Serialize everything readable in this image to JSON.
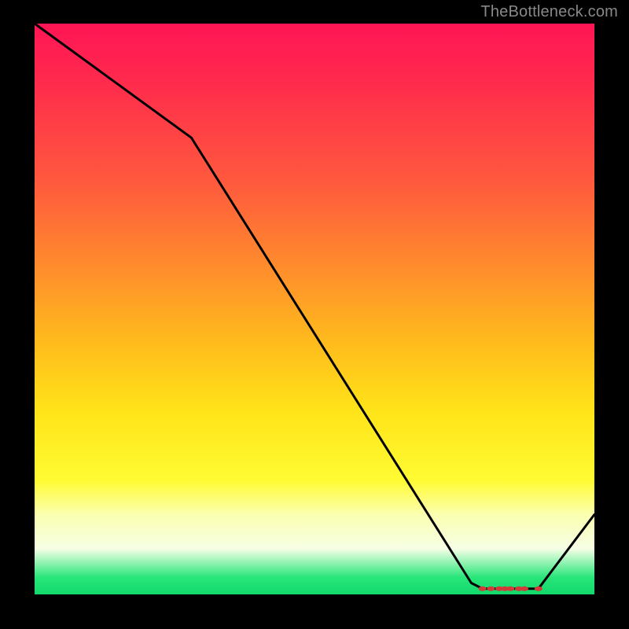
{
  "attribution": "TheBottleneck.com",
  "colors": {
    "page_bg": "#000000",
    "line_stroke": "#000000",
    "marker_stroke": "#d43a3a",
    "gradient_top": "#ff1555",
    "gradient_bottom": "#13d86b"
  },
  "chart_data": {
    "type": "line",
    "title": "",
    "xlabel": "",
    "ylabel": "",
    "xlim": [
      0,
      100
    ],
    "ylim": [
      0,
      100
    ],
    "x": [
      0,
      28,
      78,
      80,
      82,
      84,
      87,
      90,
      100
    ],
    "values": [
      100,
      80,
      2,
      1,
      1,
      1,
      1,
      1,
      14
    ],
    "markers_x": [
      80,
      81.5,
      83,
      84,
      85,
      86.5,
      87.5,
      90
    ],
    "markers_y": [
      1,
      1,
      1,
      1,
      1,
      1,
      1,
      1
    ]
  }
}
